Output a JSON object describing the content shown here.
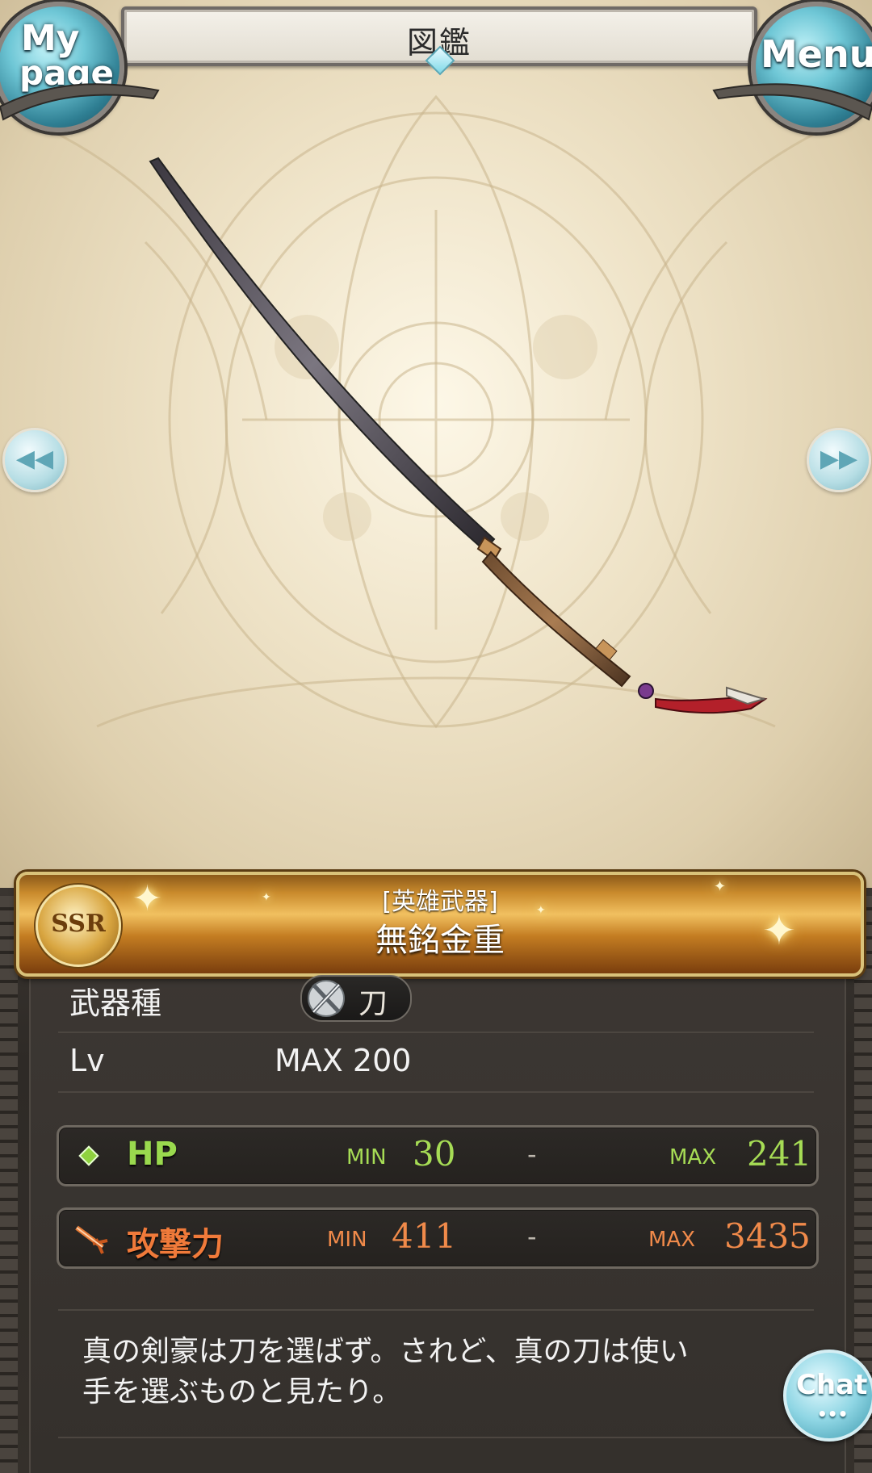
{
  "header": {
    "title": "図鑑",
    "mypage_line1": "My",
    "mypage_line2": "page",
    "menu_label": "Menu"
  },
  "weapon": {
    "rarity": "SSR",
    "category": "[英雄武器]",
    "name": "無銘金重"
  },
  "info": {
    "type_label": "武器種",
    "type_value": "刀",
    "lv_label": "Lv",
    "lv_value": "MAX 200"
  },
  "stats": {
    "hp": {
      "label": "HP",
      "min_tag": "MIN",
      "min": "30",
      "dash": "-",
      "max_tag": "MAX",
      "max": "241"
    },
    "atk": {
      "label": "攻撃力",
      "min_tag": "MIN",
      "min": "411",
      "dash": "-",
      "max_tag": "MAX",
      "max": "3435"
    }
  },
  "flavor": {
    "line1": "真の剣豪は刀を選ばず。されど、真の刀は使い",
    "line2": "手を選ぶものと見たり。"
  },
  "chat": {
    "label": "Chat",
    "dots": "•••"
  },
  "icons": [
    "left-arrow-icon",
    "right-arrow-icon",
    "katana-type-icon",
    "hp-diamond-icon",
    "attack-sword-icon",
    "ssr-rarity-icon"
  ],
  "colors": {
    "hp": "#a6dc55",
    "attack": "#f08a4a",
    "banner_gold": "#f1c060",
    "accent_cyan": "#6fc7d6"
  }
}
